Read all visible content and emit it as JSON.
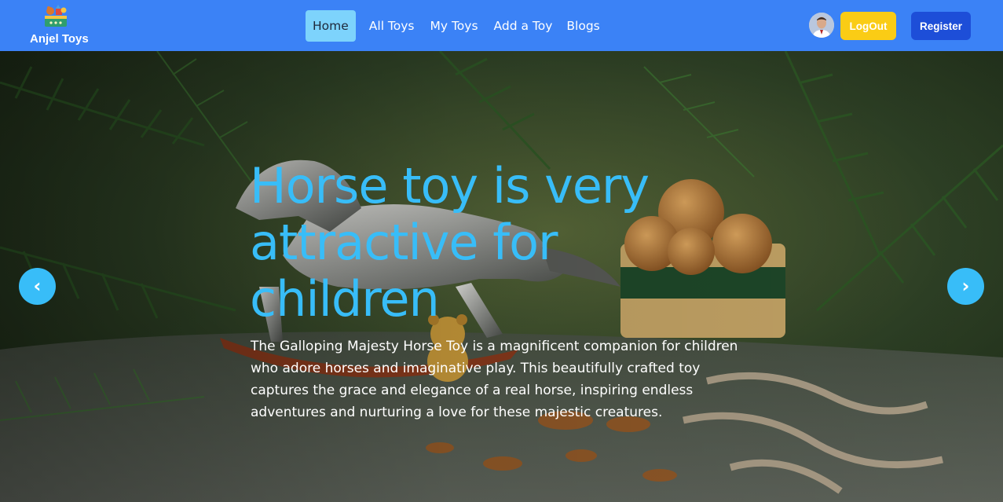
{
  "brand": {
    "name": "Anjel Toys",
    "logo_icon": "toy-basket-icon"
  },
  "nav": {
    "links": [
      {
        "label": "Home",
        "active": true
      },
      {
        "label": "All Toys",
        "active": false
      },
      {
        "label": "My Toys",
        "active": false
      },
      {
        "label": "Add a Toy",
        "active": false
      },
      {
        "label": "Blogs",
        "active": false
      }
    ]
  },
  "user": {
    "avatar_icon": "user-avatar"
  },
  "buttons": {
    "logout": "LogOut",
    "register": "Register"
  },
  "hero": {
    "title": "Horse toy is very attractive for children",
    "description": "The Galloping Majesty Horse Toy is a magnificent companion for children who adore horses and imaginative play. This beautifully crafted toy captures the grace and elegance of a real horse, inspiring endless adventures and nurturing a love for these majestic creatures.",
    "prev_arrow": "‹",
    "next_arrow": "›"
  },
  "colors": {
    "navbar": "#3b82f6",
    "active_link": "#7dd3fc",
    "logout": "#facc15",
    "register": "#1d4ed8",
    "accent": "#38bdf8"
  }
}
